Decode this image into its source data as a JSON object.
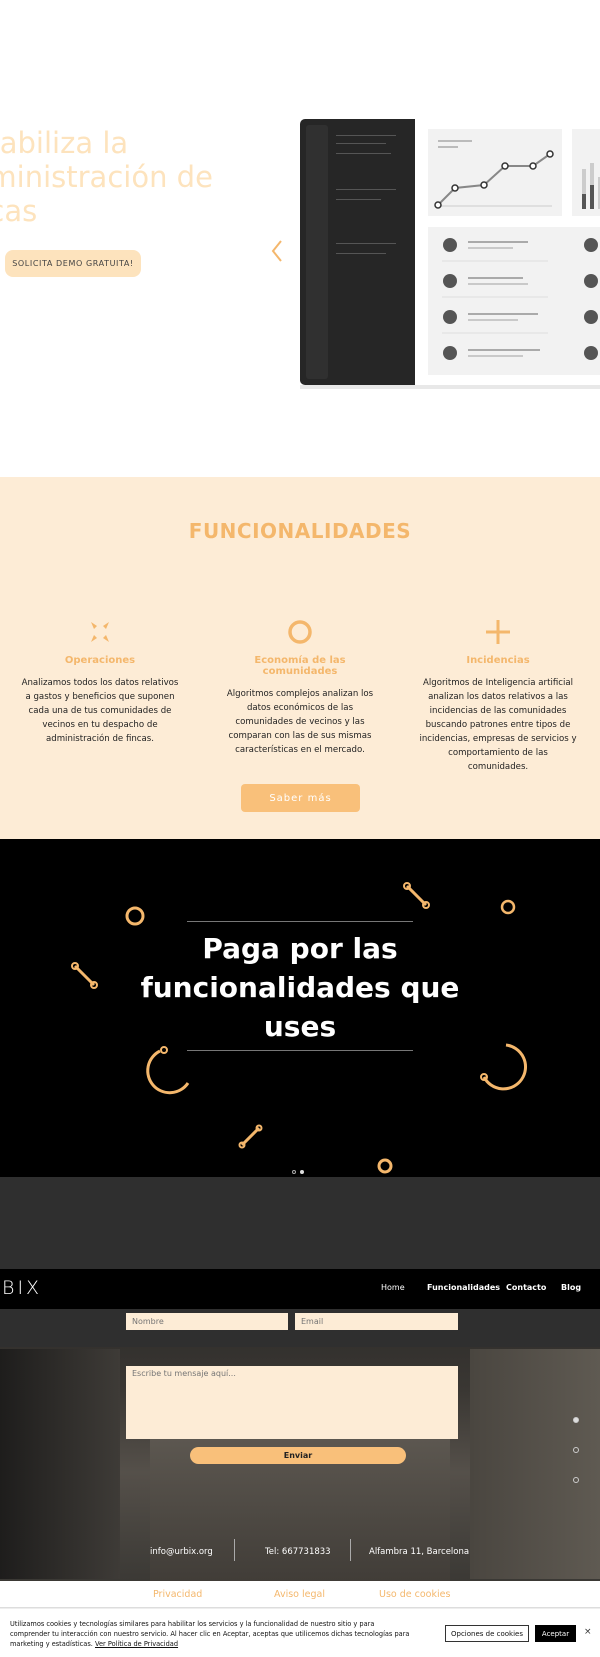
{
  "hero": {
    "title": "ntabiliza la\ndministración de\nncas",
    "demo_button": "SOLICITA DEMO GRATUITA!"
  },
  "features": {
    "section_title": "FUNCIONALIDADES",
    "items": [
      {
        "icon": "scatter-x-icon",
        "title": "Operaciones",
        "description": "Analizamos todos los datos relativos a  gastos y beneficios que suponen cada una de tus comunidades de vecinos en tu despacho de administración de fincas."
      },
      {
        "icon": "ring-icon",
        "title": "Economía de las comunidades",
        "description": "Algoritmos complejos analizan los datos económicos de las comunidades de vecinos y las comparan con las de sus mismas características en el mercado."
      },
      {
        "icon": "plus-icon",
        "title": "Incidencias",
        "description": "Algoritmos de Inteligencia artificial analizan los datos relativos a las incidencias de las comunidades buscando patrones entre tipos de incidencias, empresas de servicios y comportamiento de las comunidades."
      }
    ],
    "more_button": "Saber más"
  },
  "banner": {
    "title": "Paga por las\nfuncionalidades que\nuses"
  },
  "nav": {
    "logo": "BIX",
    "items": [
      "Home",
      "Funcionalidades",
      "Contacto",
      "Blog"
    ]
  },
  "contact": {
    "name_placeholder": "Nombre",
    "email_placeholder": "Email",
    "message_placeholder": "Escribe tu mensaje aquí...",
    "send_button": "Enviar",
    "email": "info@urbix.org",
    "phone": "Tel: 667731833",
    "address": "Alfambra 11, Barcelona"
  },
  "footer": {
    "links": [
      "Privacidad",
      "Aviso legal",
      "Uso de cookies"
    ]
  },
  "cookies": {
    "text": "Utilizamos cookies y tecnologías similares para habilitar los servicios y la funcionalidad de nuestro sitio y para comprender tu interacción con nuestro servicio. Al hacer clic en Aceptar, aceptas que utilicemos dichas tecnologías para marketing y estadísticas.",
    "policy_link": "Ver Política de Privacidad",
    "options_button": "Opciones de cookies",
    "accept_button": "Aceptar",
    "close": "×"
  },
  "colors": {
    "accent": "#f4b76c",
    "cream": "#fdecd6",
    "dark": "#000000"
  }
}
